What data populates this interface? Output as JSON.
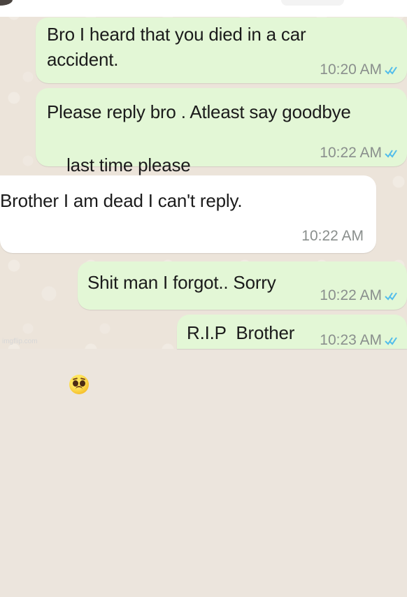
{
  "chat": {
    "messages": [
      {
        "text": "Bro I heard that you died in a car\naccident.",
        "time": "10:20 AM"
      },
      {
        "text_line1": "Please reply bro . Atleast say goodbye",
        "text_line2": "last time please",
        "emoji_name": "pleading-face-icon",
        "time": "10:22 AM"
      },
      {
        "text": "Brother I am dead I can't reply.",
        "time": "10:22 AM"
      },
      {
        "text": "Shit man I forgot.. Sorry",
        "time": "10:22 AM"
      },
      {
        "text": "R.I.P  Brother",
        "time": "10:23 AM"
      }
    ]
  },
  "footer": {
    "watermark": "imgflip.com"
  },
  "colors": {
    "background": "#ece4da",
    "outgoing_bubble": "#e3f7d6",
    "incoming_bubble": "#ffffff",
    "tick_blue": "#53bdeb"
  }
}
